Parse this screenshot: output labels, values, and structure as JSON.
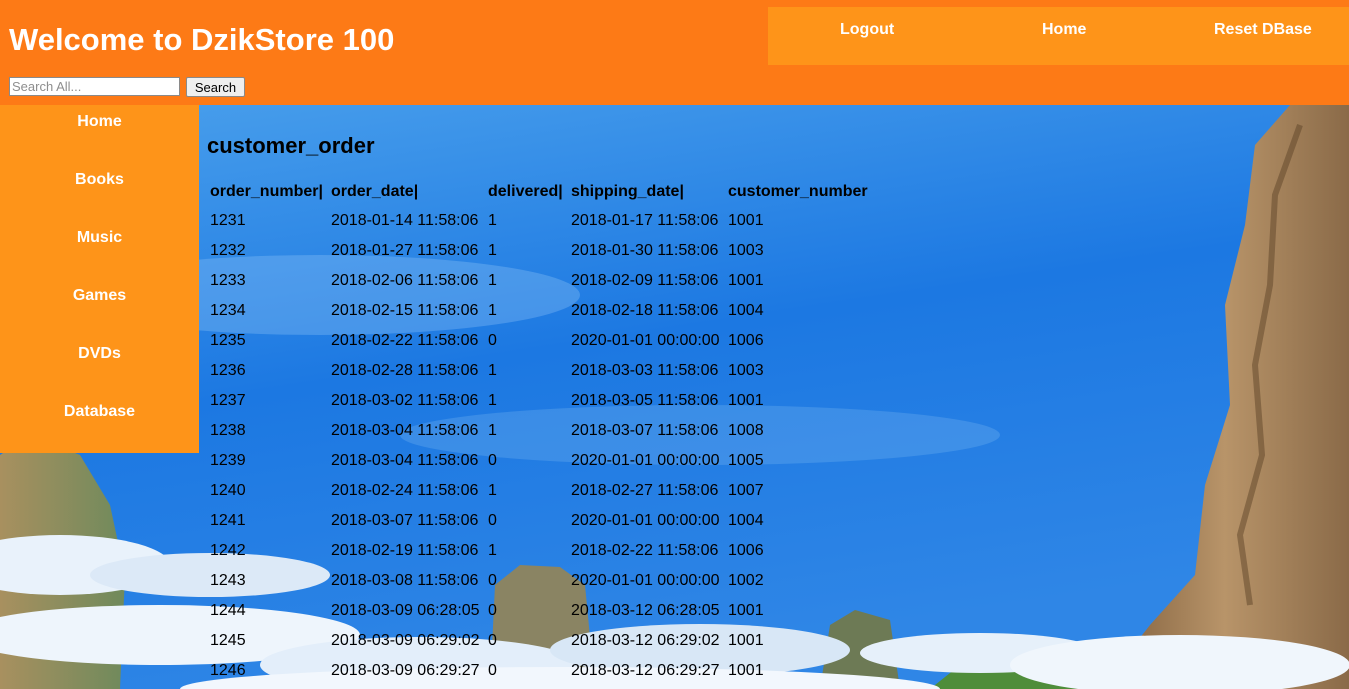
{
  "header": {
    "title": "Welcome to DzikStore 100",
    "nav": [
      "Logout",
      "Home",
      "Reset DBase"
    ],
    "search_placeholder": "Search All...",
    "search_value": "",
    "search_button": "Search"
  },
  "sidebar": {
    "items": [
      "Home",
      "Books",
      "Music",
      "Games",
      "DVDs",
      "Database"
    ]
  },
  "main": {
    "table_title": "customer_order",
    "columns": [
      "order_number|",
      "order_date|",
      "delivered|",
      "shipping_date|",
      "customer_number"
    ],
    "rows": [
      [
        "1231",
        "2018-01-14 11:58:06",
        "1",
        "2018-01-17 11:58:06",
        "1001"
      ],
      [
        "1232",
        "2018-01-27 11:58:06",
        "1",
        "2018-01-30 11:58:06",
        "1003"
      ],
      [
        "1233",
        "2018-02-06 11:58:06",
        "1",
        "2018-02-09 11:58:06",
        "1001"
      ],
      [
        "1234",
        "2018-02-15 11:58:06",
        "1",
        "2018-02-18 11:58:06",
        "1004"
      ],
      [
        "1235",
        "2018-02-22 11:58:06",
        "0",
        "2020-01-01 00:00:00",
        "1006"
      ],
      [
        "1236",
        "2018-02-28 11:58:06",
        "1",
        "2018-03-03 11:58:06",
        "1003"
      ],
      [
        "1237",
        "2018-03-02 11:58:06",
        "1",
        "2018-03-05 11:58:06",
        "1001"
      ],
      [
        "1238",
        "2018-03-04 11:58:06",
        "1",
        "2018-03-07 11:58:06",
        "1008"
      ],
      [
        "1239",
        "2018-03-04 11:58:06",
        "0",
        "2020-01-01 00:00:00",
        "1005"
      ],
      [
        "1240",
        "2018-02-24 11:58:06",
        "1",
        "2018-02-27 11:58:06",
        "1007"
      ],
      [
        "1241",
        "2018-03-07 11:58:06",
        "0",
        "2020-01-01 00:00:00",
        "1004"
      ],
      [
        "1242",
        "2018-02-19 11:58:06",
        "1",
        "2018-02-22 11:58:06",
        "1006"
      ],
      [
        "1243",
        "2018-03-08 11:58:06",
        "0",
        "2020-01-01 00:00:00",
        "1002"
      ],
      [
        "1244",
        "2018-03-09 06:28:05",
        "0",
        "2018-03-12 06:28:05",
        "1001"
      ],
      [
        "1245",
        "2018-03-09 06:29:02",
        "0",
        "2018-03-12 06:29:02",
        "1001"
      ],
      [
        "1246",
        "2018-03-09 06:29:27",
        "0",
        "2018-03-12 06:29:27",
        "1001"
      ]
    ]
  },
  "colors": {
    "header_bg": "#fd7a16",
    "nav_bg": "#fe9419",
    "sky": "#2a7fe0"
  }
}
